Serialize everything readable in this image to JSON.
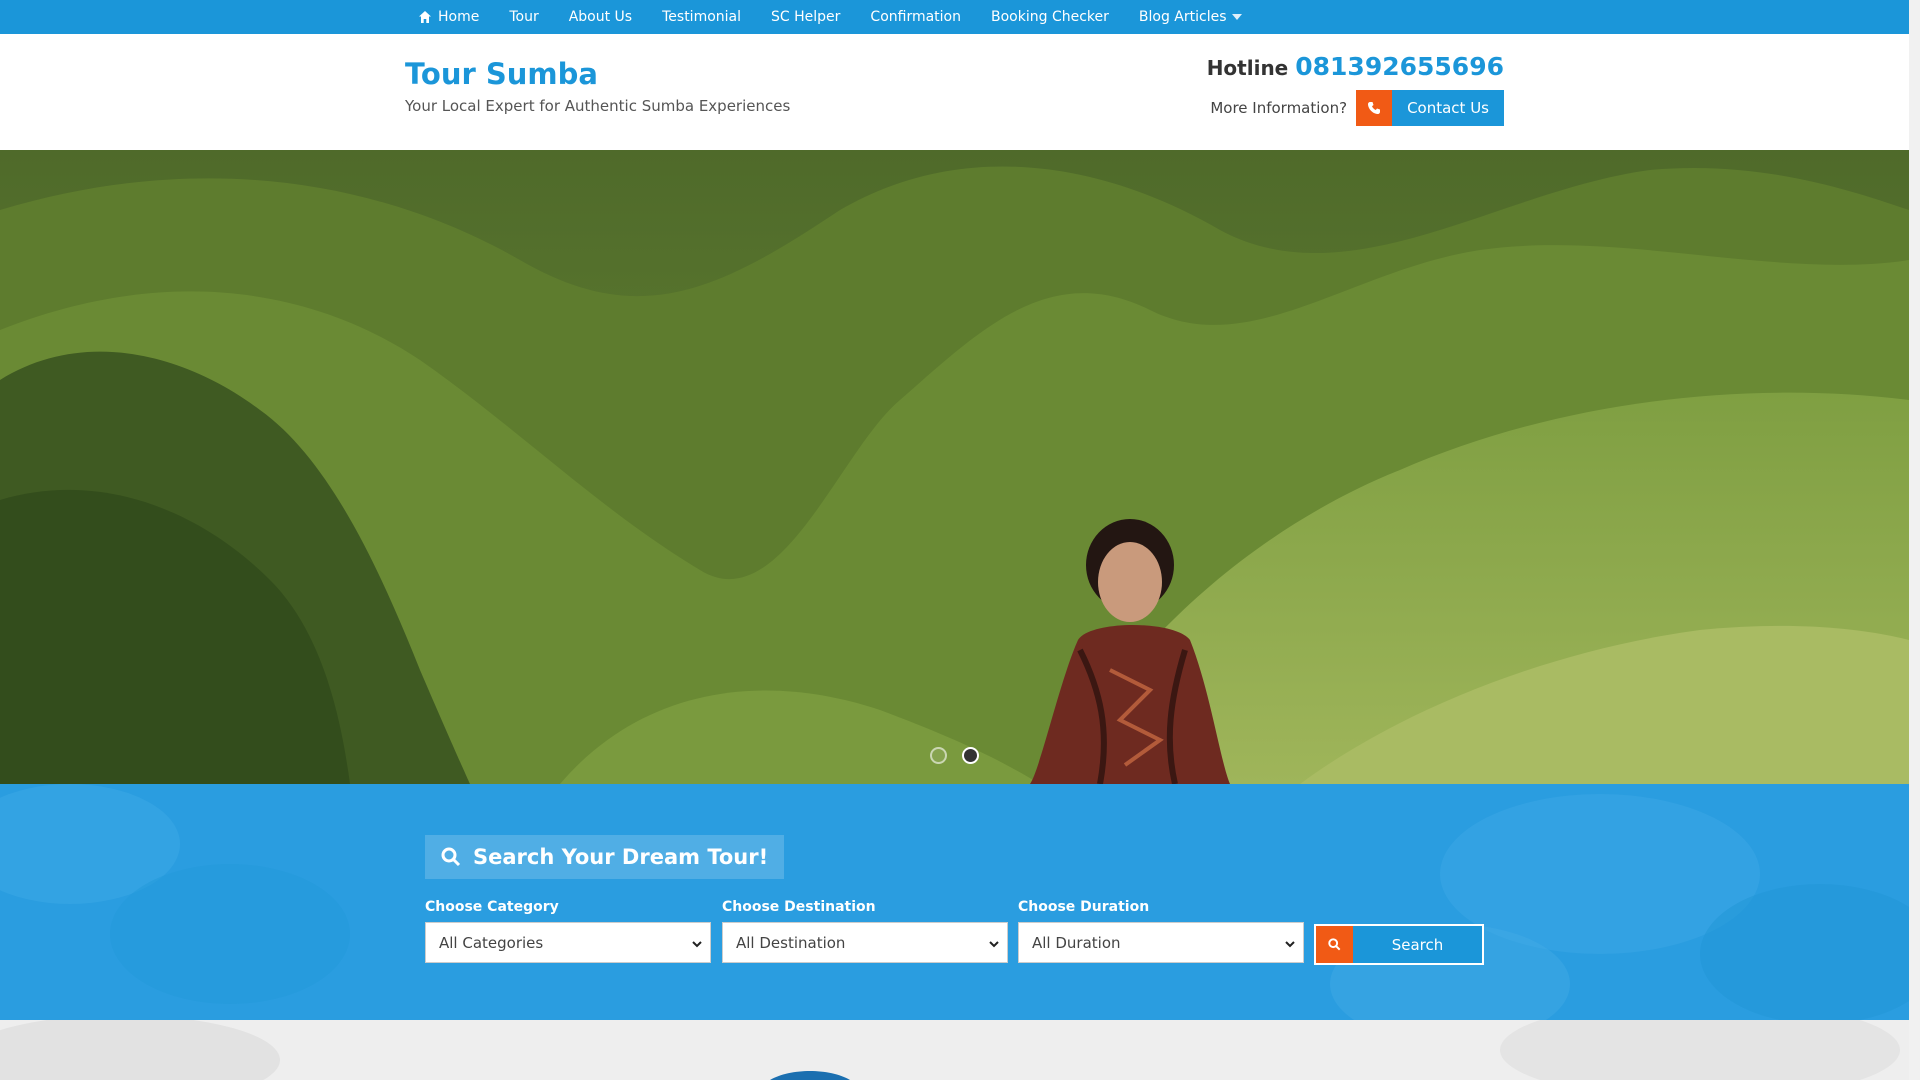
{
  "nav": {
    "items": [
      {
        "label": "Home",
        "icon": "home-icon"
      },
      {
        "label": "Tour"
      },
      {
        "label": "About Us"
      },
      {
        "label": "Testimonial"
      },
      {
        "label": "SC Helper"
      },
      {
        "label": "Confirmation"
      },
      {
        "label": "Booking Checker"
      },
      {
        "label": "Blog Articles",
        "icon": "caret-down-icon"
      }
    ]
  },
  "header": {
    "brand": "Tour Sumba",
    "tagline": "Your Local Expert for Authentic Sumba Experiences",
    "hotline_label": "Hotline",
    "hotline_number": "081392655696",
    "more_info": "More Information?",
    "contact_label": "Contact Us",
    "contact_icon": "phone-icon"
  },
  "hero": {
    "slide_count": 2,
    "active_slide": 2
  },
  "search": {
    "title": "Search Your Dream Tour!",
    "category": {
      "label": "Choose Category",
      "value": "All Categories"
    },
    "destination": {
      "label": "Choose Destination",
      "value": "All Destination"
    },
    "duration": {
      "label": "Choose Duration",
      "value": "All Duration"
    },
    "button_label": "Search"
  },
  "colors": {
    "primary": "#1b96d9",
    "accent": "#f15a15"
  }
}
